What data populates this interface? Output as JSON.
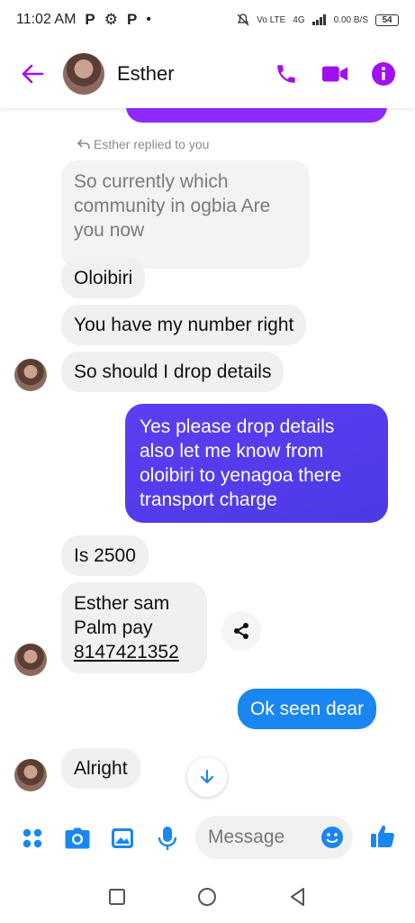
{
  "status_bar": {
    "time": "11:02 AM",
    "notif_icons": [
      "P",
      "⚙",
      "P",
      "•"
    ],
    "network": "Vo LTE",
    "signal": "4G",
    "data_rate": "0.00 B/S",
    "battery": "54"
  },
  "header": {
    "contact_name": "Esther",
    "icons": [
      "back-arrow-icon",
      "phone-icon",
      "video-icon",
      "info-icon"
    ],
    "accent_color": "#a20ff0"
  },
  "reply": {
    "label": "Esther replied to you",
    "quote": "So currently which community in ogbia Are you now"
  },
  "messages": [
    {
      "dir": "in",
      "text": "Oloibiri"
    },
    {
      "dir": "in",
      "text": "You have my number right"
    },
    {
      "dir": "in",
      "text": "So should I drop details"
    },
    {
      "dir": "out",
      "text": "Yes please drop details also let me know from oloibiri to yenagoa there transport charge"
    },
    {
      "dir": "in",
      "text": "Is 2500"
    },
    {
      "dir": "in",
      "lines": [
        "Esther sam",
        "Palm pay",
        "8147421352"
      ]
    },
    {
      "dir": "out",
      "text": "Ok seen dear"
    },
    {
      "dir": "in",
      "text": "Alright"
    }
  ],
  "composer": {
    "placeholder": "Message",
    "icons": [
      "apps-icon",
      "camera-icon",
      "image-icon",
      "mic-icon",
      "emoji-icon",
      "like-icon"
    ],
    "icon_color": "#1a86f2"
  },
  "nav": {
    "icons": [
      "square-icon",
      "circle-icon",
      "triangle-back-icon"
    ]
  }
}
